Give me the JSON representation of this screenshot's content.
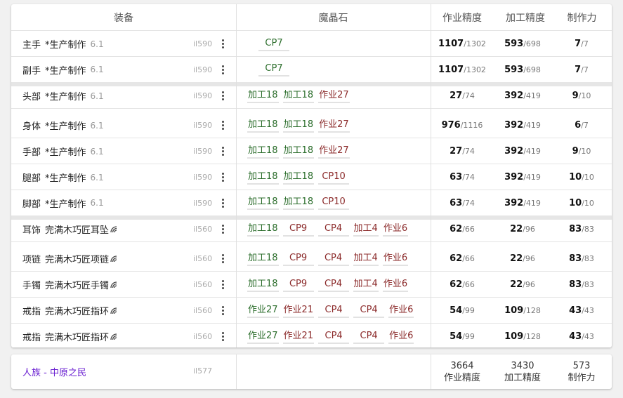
{
  "headers": {
    "gear": "装备",
    "materia": "魔晶石",
    "craftsmanship": "作业精度",
    "control": "加工精度",
    "cp": "制作力"
  },
  "rows": [
    {
      "slot": "主手",
      "name": "*生产制作",
      "ver": "6.1",
      "ilvl": "il590",
      "materias": [
        {
          "t": "CP7",
          "k": "c",
          "w": 1
        }
      ],
      "s1": "1107",
      "m1": "/1302",
      "s2": "593",
      "m2": "/698",
      "s3": "7",
      "m3": "/7"
    },
    {
      "slot": "副手",
      "name": "*生产制作",
      "ver": "6.1",
      "ilvl": "il590",
      "materias": [
        {
          "t": "CP7",
          "k": "c",
          "w": 1
        }
      ],
      "s1": "1107",
      "m1": "/1302",
      "s2": "593",
      "m2": "/698",
      "s3": "7",
      "m3": "/7"
    },
    {
      "slot": "头部",
      "name": "*生产制作",
      "ver": "6.1",
      "ilvl": "il590",
      "materias": [
        {
          "t": "加工18",
          "k": "c"
        },
        {
          "t": "加工18",
          "k": "c"
        },
        {
          "t": "作业27",
          "k": "r"
        }
      ],
      "s1": "27",
      "m1": "/74",
      "s2": "392",
      "m2": "/419",
      "s3": "9",
      "m3": "/10"
    },
    {
      "slot": "身体",
      "name": "*生产制作",
      "ver": "6.1",
      "ilvl": "il590",
      "materias": [
        {
          "t": "加工18",
          "k": "c"
        },
        {
          "t": "加工18",
          "k": "c"
        },
        {
          "t": "作业27",
          "k": "r"
        }
      ],
      "s1": "976",
      "m1": "/1116",
      "s2": "392",
      "m2": "/419",
      "s3": "6",
      "m3": "/7"
    },
    {
      "slot": "手部",
      "name": "*生产制作",
      "ver": "6.1",
      "ilvl": "il590",
      "materias": [
        {
          "t": "加工18",
          "k": "c"
        },
        {
          "t": "加工18",
          "k": "c"
        },
        {
          "t": "作业27",
          "k": "r"
        }
      ],
      "s1": "27",
      "m1": "/74",
      "s2": "392",
      "m2": "/419",
      "s3": "9",
      "m3": "/10"
    },
    {
      "slot": "腿部",
      "name": "*生产制作",
      "ver": "6.1",
      "ilvl": "il590",
      "materias": [
        {
          "t": "加工18",
          "k": "c"
        },
        {
          "t": "加工18",
          "k": "c"
        },
        {
          "t": "CP10",
          "k": "r",
          "w": 1
        }
      ],
      "s1": "63",
      "m1": "/74",
      "s2": "392",
      "m2": "/419",
      "s3": "10",
      "m3": "/10"
    },
    {
      "slot": "脚部",
      "name": "*生产制作",
      "ver": "6.1",
      "ilvl": "il590",
      "materias": [
        {
          "t": "加工18",
          "k": "c"
        },
        {
          "t": "加工18",
          "k": "c"
        },
        {
          "t": "CP10",
          "k": "r",
          "w": 1
        }
      ],
      "s1": "63",
      "m1": "/74",
      "s2": "392",
      "m2": "/419",
      "s3": "10",
      "m3": "/10"
    },
    {
      "slot": "耳饰",
      "name": "完满木巧匠耳坠",
      "ver": "",
      "ilvl": "il560",
      "materias": [
        {
          "t": "加工18",
          "k": "c"
        },
        {
          "t": "CP9",
          "k": "r",
          "w": 1
        },
        {
          "t": "CP4",
          "k": "r",
          "w": 1
        },
        {
          "t": "加工4",
          "k": "r"
        },
        {
          "t": "作业6",
          "k": "r"
        }
      ],
      "s1": "62",
      "m1": "/66",
      "s2": "22",
      "m2": "/96",
      "s3": "83",
      "m3": "/83"
    },
    {
      "slot": "项链",
      "name": "完满木巧匠项链",
      "ver": "",
      "ilvl": "il560",
      "materias": [
        {
          "t": "加工18",
          "k": "c"
        },
        {
          "t": "CP9",
          "k": "r",
          "w": 1
        },
        {
          "t": "CP4",
          "k": "r",
          "w": 1
        },
        {
          "t": "加工4",
          "k": "r"
        },
        {
          "t": "作业6",
          "k": "r"
        }
      ],
      "s1": "62",
      "m1": "/66",
      "s2": "22",
      "m2": "/96",
      "s3": "83",
      "m3": "/83"
    },
    {
      "slot": "手镯",
      "name": "完满木巧匠手镯",
      "ver": "",
      "ilvl": "il560",
      "materias": [
        {
          "t": "加工18",
          "k": "c"
        },
        {
          "t": "CP9",
          "k": "r",
          "w": 1
        },
        {
          "t": "CP4",
          "k": "r",
          "w": 1
        },
        {
          "t": "加工4",
          "k": "r"
        },
        {
          "t": "作业6",
          "k": "r"
        }
      ],
      "s1": "62",
      "m1": "/66",
      "s2": "22",
      "m2": "/96",
      "s3": "83",
      "m3": "/83"
    },
    {
      "slot": "戒指",
      "name": "完满木巧匠指环",
      "ver": "",
      "ilvl": "il560",
      "materias": [
        {
          "t": "作业27",
          "k": "c"
        },
        {
          "t": "作业21",
          "k": "r"
        },
        {
          "t": "CP4",
          "k": "r",
          "w": 1
        },
        {
          "t": "CP4",
          "k": "r",
          "w": 1
        },
        {
          "t": "作业6",
          "k": "r"
        }
      ],
      "s1": "54",
      "m1": "/99",
      "s2": "109",
      "m2": "/128",
      "s3": "43",
      "m3": "/43"
    },
    {
      "slot": "戒指",
      "name": "完满木巧匠指环",
      "ver": "",
      "ilvl": "il560",
      "materias": [
        {
          "t": "作业27",
          "k": "c"
        },
        {
          "t": "作业21",
          "k": "r"
        },
        {
          "t": "CP4",
          "k": "r",
          "w": 1
        },
        {
          "t": "CP4",
          "k": "r",
          "w": 1
        },
        {
          "t": "作业6",
          "k": "r"
        }
      ],
      "s1": "54",
      "m1": "/99",
      "s2": "109",
      "m2": "/128",
      "s3": "43",
      "m3": "/43"
    }
  ],
  "summary": {
    "race": "人族 - 中原之民",
    "ilvl": "il577",
    "craftsmanship": "3664",
    "craftsmanship_label": "作业精度",
    "control": "3430",
    "control_label": "加工精度",
    "cp": "573",
    "cp_label": "制作力"
  },
  "colors": {
    "craft_materia": "#2c6e2c",
    "other_materia": "#8b2a2a",
    "race_link": "#6a1fd1"
  },
  "icons": {
    "row_menu": "more-vert-icon",
    "high_quality": "hq-icon"
  }
}
